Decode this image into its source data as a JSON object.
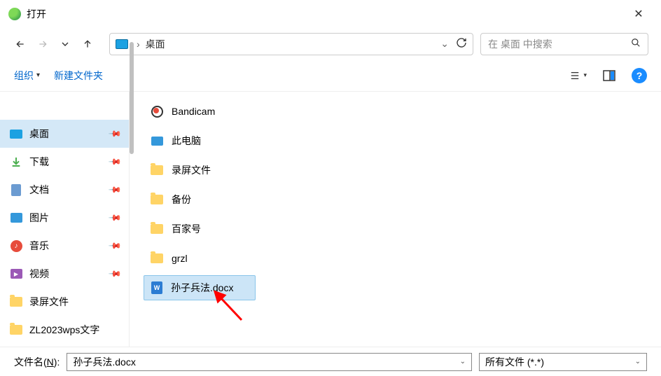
{
  "titlebar": {
    "title": "打开"
  },
  "addressbar": {
    "crumbs": [
      "桌面"
    ],
    "search_placeholder": "在 桌面 中搜索"
  },
  "toolbar": {
    "organize": "组织",
    "newfolder": "新建文件夹"
  },
  "sidebar": {
    "items": [
      {
        "label": "桌面",
        "icon": "monitor",
        "pinned": true,
        "selected": true
      },
      {
        "label": "下载",
        "icon": "download",
        "pinned": true
      },
      {
        "label": "文档",
        "icon": "document",
        "pinned": true
      },
      {
        "label": "图片",
        "icon": "picture",
        "pinned": true
      },
      {
        "label": "音乐",
        "icon": "music",
        "pinned": true
      },
      {
        "label": "视频",
        "icon": "video",
        "pinned": true
      },
      {
        "label": "录屏文件",
        "icon": "folder"
      },
      {
        "label": "ZL2023wps文字",
        "icon": "folder"
      }
    ]
  },
  "filelist": {
    "items": [
      {
        "name": "Bandicam",
        "type": "app"
      },
      {
        "name": "此电脑",
        "type": "thispc"
      },
      {
        "name": "录屏文件",
        "type": "folder"
      },
      {
        "name": "备份",
        "type": "folder"
      },
      {
        "name": "百家号",
        "type": "folder"
      },
      {
        "name": "grzl",
        "type": "folder"
      },
      {
        "name": "孙子兵法.docx",
        "type": "docx",
        "selected": true
      }
    ]
  },
  "footer": {
    "label_prefix": "文件名(",
    "label_underline": "N",
    "label_suffix": "):",
    "filename_value": "孙子兵法.docx",
    "filter_value": "所有文件 (*.*)"
  }
}
